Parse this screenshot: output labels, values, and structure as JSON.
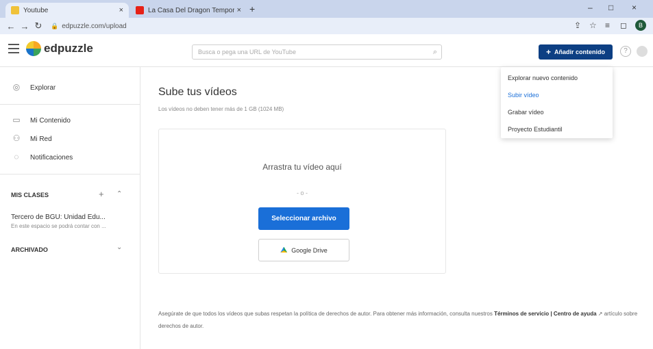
{
  "browser": {
    "tabs": [
      {
        "title": "Youtube",
        "active": true,
        "fav_color": "#f0c23a"
      },
      {
        "title": "La Casa Del Dragon Temporada • ▾",
        "active": false,
        "fav_color": "#e62117"
      }
    ],
    "new_tab": "+",
    "controls": {
      "minimize": "–",
      "maximize": "□",
      "close": "×"
    },
    "url": "edpuzzle.com/upload",
    "profile_initial": "B"
  },
  "app": {
    "logo_text": "edpuzzle",
    "search_placeholder": "Busca o pega una URL de YouTube",
    "add_button": "Añadir contenido",
    "help": "?"
  },
  "sidebar": {
    "items": [
      {
        "label": "Explorar",
        "icon": "compass-icon"
      },
      {
        "label": "Mi Contenido",
        "icon": "folder-icon"
      },
      {
        "label": "Mi Red",
        "icon": "network-icon"
      },
      {
        "label": "Notificaciones",
        "icon": "bell-icon"
      }
    ],
    "classes_heading": "MIS CLASES",
    "class_title": "Tercero de BGU: Unidad Edu...",
    "class_desc": "En este espacio se podrá contar con ...",
    "archived_heading": "ARCHIVADO"
  },
  "main": {
    "title": "Sube tus vídeos",
    "subtitle": "Los vídeos no deben tener más de 1 GB (1024 MB)",
    "drop_text": "Arrastra tu vídeo aquí",
    "drop_or": "- o -",
    "select_button": "Seleccionar archivo",
    "gdrive_button": "Google Drive",
    "notice_prefix": "Asegúrate de que todos los vídeos que subas respetan la política de derechos de autor. Para obtener más información, consulta nuestros",
    "notice_terms": "Términos de servicio",
    "notice_sep": "|",
    "notice_help": "Centro de ayuda",
    "notice_suffix": "artículo sobre derechos de autor."
  },
  "dropdown": {
    "items": [
      {
        "label": "Explorar nuevo contenido",
        "active": false
      },
      {
        "label": "Subir vídeo",
        "active": true
      },
      {
        "label": "Grabar vídeo",
        "active": false
      },
      {
        "label": "Proyecto Estudiantil",
        "active": false
      }
    ]
  }
}
